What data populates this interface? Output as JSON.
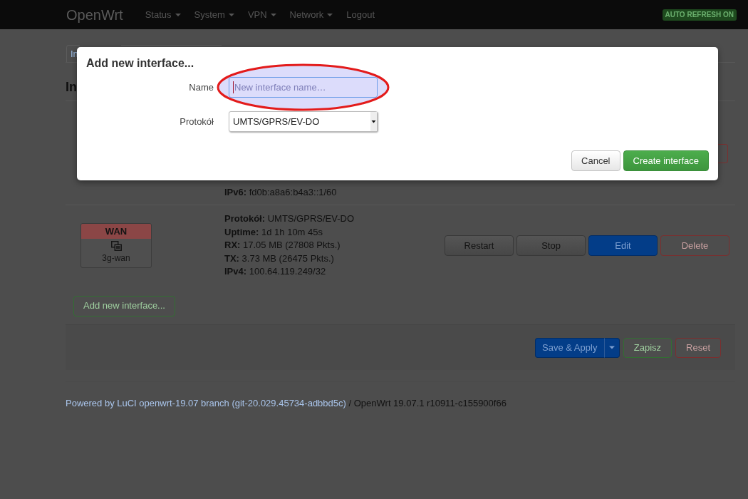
{
  "header": {
    "brand": "OpenWrt",
    "menu": [
      {
        "label": "Status",
        "dropdown": true
      },
      {
        "label": "System",
        "dropdown": true
      },
      {
        "label": "VPN",
        "dropdown": true
      },
      {
        "label": "Network",
        "dropdown": true
      },
      {
        "label": "Logout",
        "dropdown": false
      }
    ],
    "badge": "AUTO REFRESH ON"
  },
  "tabs": [
    {
      "label": "In",
      "selected": true
    }
  ],
  "heading": "In",
  "interfaces": [
    {
      "details": [
        "**IPv6:** fd0b:a8a6:b4a3::1/60"
      ],
      "actions": [
        {
          "kind": "negative"
        }
      ]
    },
    {
      "zone": {
        "name": "WAN",
        "color": "#8b4646",
        "device": "3g-wan"
      },
      "details": [
        "**Protokół:** UMTS/GPRS/EV-DO",
        "**Uptime:** 1d 1h 10m 45s",
        "**RX:** 17.05 MB (27808 Pkts.)",
        "**TX:** 3.73 MB (26475 Pkts.)",
        "**IPv4:** 100.64.119.249/32"
      ],
      "actions": [
        {
          "label": "Restart",
          "kind": "default"
        },
        {
          "label": "Stop",
          "kind": "default"
        },
        {
          "label": "Edit",
          "kind": "primary"
        },
        {
          "label": "Delete",
          "kind": "negative"
        }
      ]
    }
  ],
  "add_button": "Add new interface...",
  "page_actions": [
    {
      "label": "Save & Apply",
      "kind": "primary",
      "dropdown": true
    },
    {
      "label": "Zapisz",
      "kind": "positive",
      "dropdown": false
    },
    {
      "label": "Reset",
      "kind": "negative",
      "dropdown": false
    }
  ],
  "footer": {
    "link": "Powered by LuCI openwrt-19.07 branch (git-20.029.45734-adbbd5c)",
    "text": "/ OpenWrt 19.07.1 r10911-c155900f66"
  },
  "dialog": {
    "title": "Add new interface...",
    "fields": [
      {
        "kind": "text",
        "label": "Name",
        "placeholder": "New interface name…",
        "focused": true,
        "highlighted": true
      },
      {
        "kind": "select",
        "label": "Protokół",
        "value": "UMTS/GPRS/EV-DO"
      }
    ],
    "buttons": [
      {
        "label": "Cancel",
        "kind": "default"
      },
      {
        "label": "Create interface",
        "kind": "positive"
      }
    ]
  }
}
